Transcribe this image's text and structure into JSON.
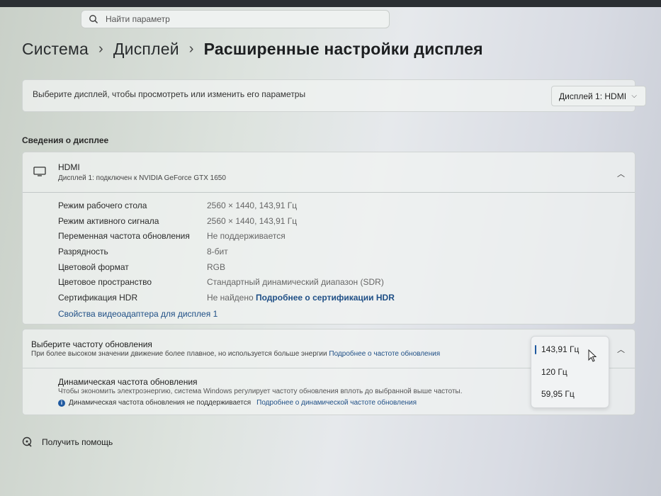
{
  "search": {
    "placeholder": "Найти параметр"
  },
  "breadcrumb": {
    "level1": "Система",
    "level2": "Дисплей",
    "current": "Расширенные настройки дисплея"
  },
  "display_select": {
    "label": "Выберите дисплей, чтобы просмотреть или изменить его параметры",
    "value": "Дисплей 1: HDMI"
  },
  "info": {
    "section_title": "Сведения о дисплее",
    "name": "HDMI",
    "subtitle": "Дисплей 1: подключен к NVIDIA GeForce GTX 1650",
    "rows": [
      {
        "label": "Режим рабочего стола",
        "value": "2560 × 1440, 143,91 Гц"
      },
      {
        "label": "Режим активного сигнала",
        "value": "2560 × 1440, 143,91 Гц"
      },
      {
        "label": "Переменная частота обновления",
        "value": "Не поддерживается"
      },
      {
        "label": "Разрядность",
        "value": "8-бит"
      },
      {
        "label": "Цветовой формат",
        "value": "RGB"
      },
      {
        "label": "Цветовое пространство",
        "value": "Стандартный динамический диапазон (SDR)"
      },
      {
        "label": "Сертификация HDR",
        "value": "Не найдено",
        "link": "Подробнее о сертификации HDR"
      }
    ],
    "adapter_link": "Свойства видеоадаптера для дисплея 1"
  },
  "refresh": {
    "title": "Выберите частоту обновления",
    "desc": "При более высоком значении движение более плавное, но используется больше энергии",
    "desc_link": "Подробнее о частоте обновления",
    "options": [
      "143,91 Гц",
      "120 Гц",
      "59,95 Гц"
    ],
    "selected": "143,91 Гц",
    "dynamic_title": "Динамическая частота обновления",
    "dynamic_desc": "Чтобы экономить электроэнергию, система Windows регулирует частоту обновления вплоть до выбранной выше частоты.",
    "dynamic_note": "Динамическая частота обновления не поддерживается",
    "dynamic_link": "Подробнее о динамической частоте обновления"
  },
  "help": {
    "label": "Получить помощь"
  },
  "colors": {
    "accent": "#1f5aa0",
    "link": "#1f4f86"
  }
}
